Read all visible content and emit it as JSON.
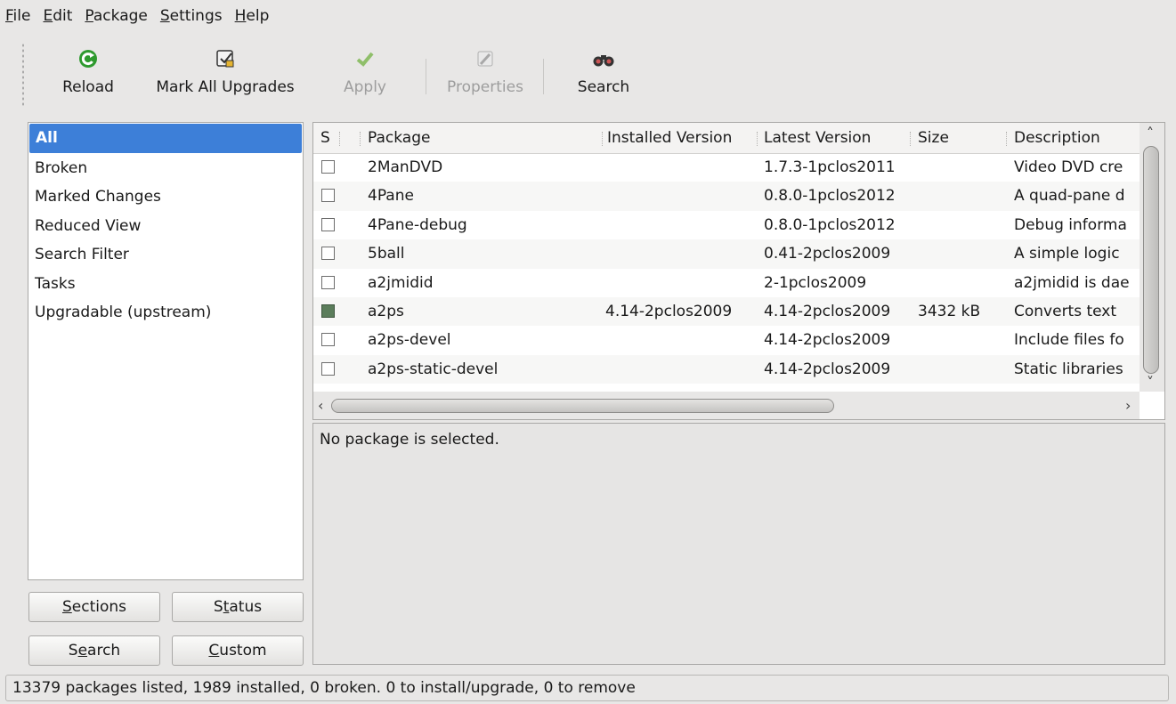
{
  "menu": [
    {
      "pre": "",
      "ul": "F",
      "post": "ile"
    },
    {
      "pre": "",
      "ul": "E",
      "post": "dit"
    },
    {
      "pre": "",
      "ul": "P",
      "post": "ackage"
    },
    {
      "pre": "",
      "ul": "S",
      "post": "ettings"
    },
    {
      "pre": "",
      "ul": "H",
      "post": "elp"
    }
  ],
  "toolbar": {
    "reload": {
      "label": "Reload",
      "icon": "reload-icon"
    },
    "mark_all": {
      "label": "Mark All Upgrades",
      "icon": "mark-upgrades-icon"
    },
    "apply": {
      "label": "Apply",
      "icon": "checkmark-icon",
      "enabled": false
    },
    "properties": {
      "label": "Properties",
      "icon": "properties-icon",
      "enabled": false
    },
    "search": {
      "label": "Search",
      "icon": "binoculars-icon"
    }
  },
  "filters": {
    "items": [
      "All",
      "Broken",
      "Marked Changes",
      "Reduced View",
      "Search Filter",
      "Tasks",
      "Upgradable (upstream)"
    ],
    "selected": "All"
  },
  "side_buttons": {
    "sections": {
      "pre": "",
      "ul": "S",
      "post": "ections"
    },
    "status": {
      "pre": "S",
      "ul": "t",
      "post": "atus"
    },
    "search": {
      "pre": "S",
      "ul": "e",
      "post": "arch"
    },
    "custom": {
      "pre": "",
      "ul": "C",
      "post": "ustom"
    }
  },
  "table": {
    "columns": [
      "S",
      "Package",
      "Installed Version",
      "Latest Version",
      "Size",
      "Description"
    ],
    "rows": [
      {
        "installed_state": false,
        "package": "2ManDVD",
        "installed": "",
        "latest": "1.7.3-1pclos2011",
        "size": "",
        "description": "Video DVD cre"
      },
      {
        "installed_state": false,
        "package": "4Pane",
        "installed": "",
        "latest": "0.8.0-1pclos2012",
        "size": "",
        "description": "A quad-pane d"
      },
      {
        "installed_state": false,
        "package": "4Pane-debug",
        "installed": "",
        "latest": "0.8.0-1pclos2012",
        "size": "",
        "description": "Debug informa"
      },
      {
        "installed_state": false,
        "package": "5ball",
        "installed": "",
        "latest": "0.41-2pclos2009",
        "size": "",
        "description": "A simple logic"
      },
      {
        "installed_state": false,
        "package": "a2jmidid",
        "installed": "",
        "latest": "2-1pclos2009",
        "size": "",
        "description": "a2jmidid is dae"
      },
      {
        "installed_state": true,
        "package": "a2ps",
        "installed": "4.14-2pclos2009",
        "latest": "4.14-2pclos2009",
        "size": "3432 kB",
        "description": "Converts text"
      },
      {
        "installed_state": false,
        "package": "a2ps-devel",
        "installed": "",
        "latest": "4.14-2pclos2009",
        "size": "",
        "description": "Include files fo"
      },
      {
        "installed_state": false,
        "package": "a2ps-static-devel",
        "installed": "",
        "latest": "4.14-2pclos2009",
        "size": "",
        "description": "Static libraries"
      }
    ]
  },
  "details_text": "No package is selected.",
  "status_text": "13379 packages listed, 1989 installed, 0 broken. 0 to install/upgrade, 0 to remove",
  "colors": {
    "selection": "#3d7fd8",
    "installed_checkbox": "#5b7d5b",
    "reload_icon": "#2e9a2e"
  }
}
